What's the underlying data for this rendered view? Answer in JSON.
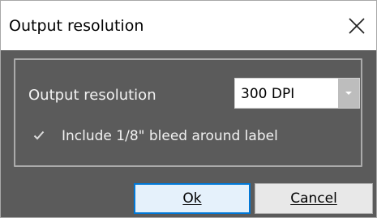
{
  "window": {
    "title": "Output resolution"
  },
  "form": {
    "resolution_label": "Output resolution",
    "resolution_value": "300 DPI",
    "checkbox_checked": true,
    "checkbox_label": "Include 1/8\" bleed around label"
  },
  "buttons": {
    "ok_label": "Ok",
    "cancel_label": "Cancel"
  },
  "icons": {
    "close": "close-icon",
    "dropdown": "chevron-down-icon",
    "check": "checkmark-icon"
  },
  "colors": {
    "dialog_background": "#5b5b5b",
    "default_button_border": "#0078d7"
  }
}
